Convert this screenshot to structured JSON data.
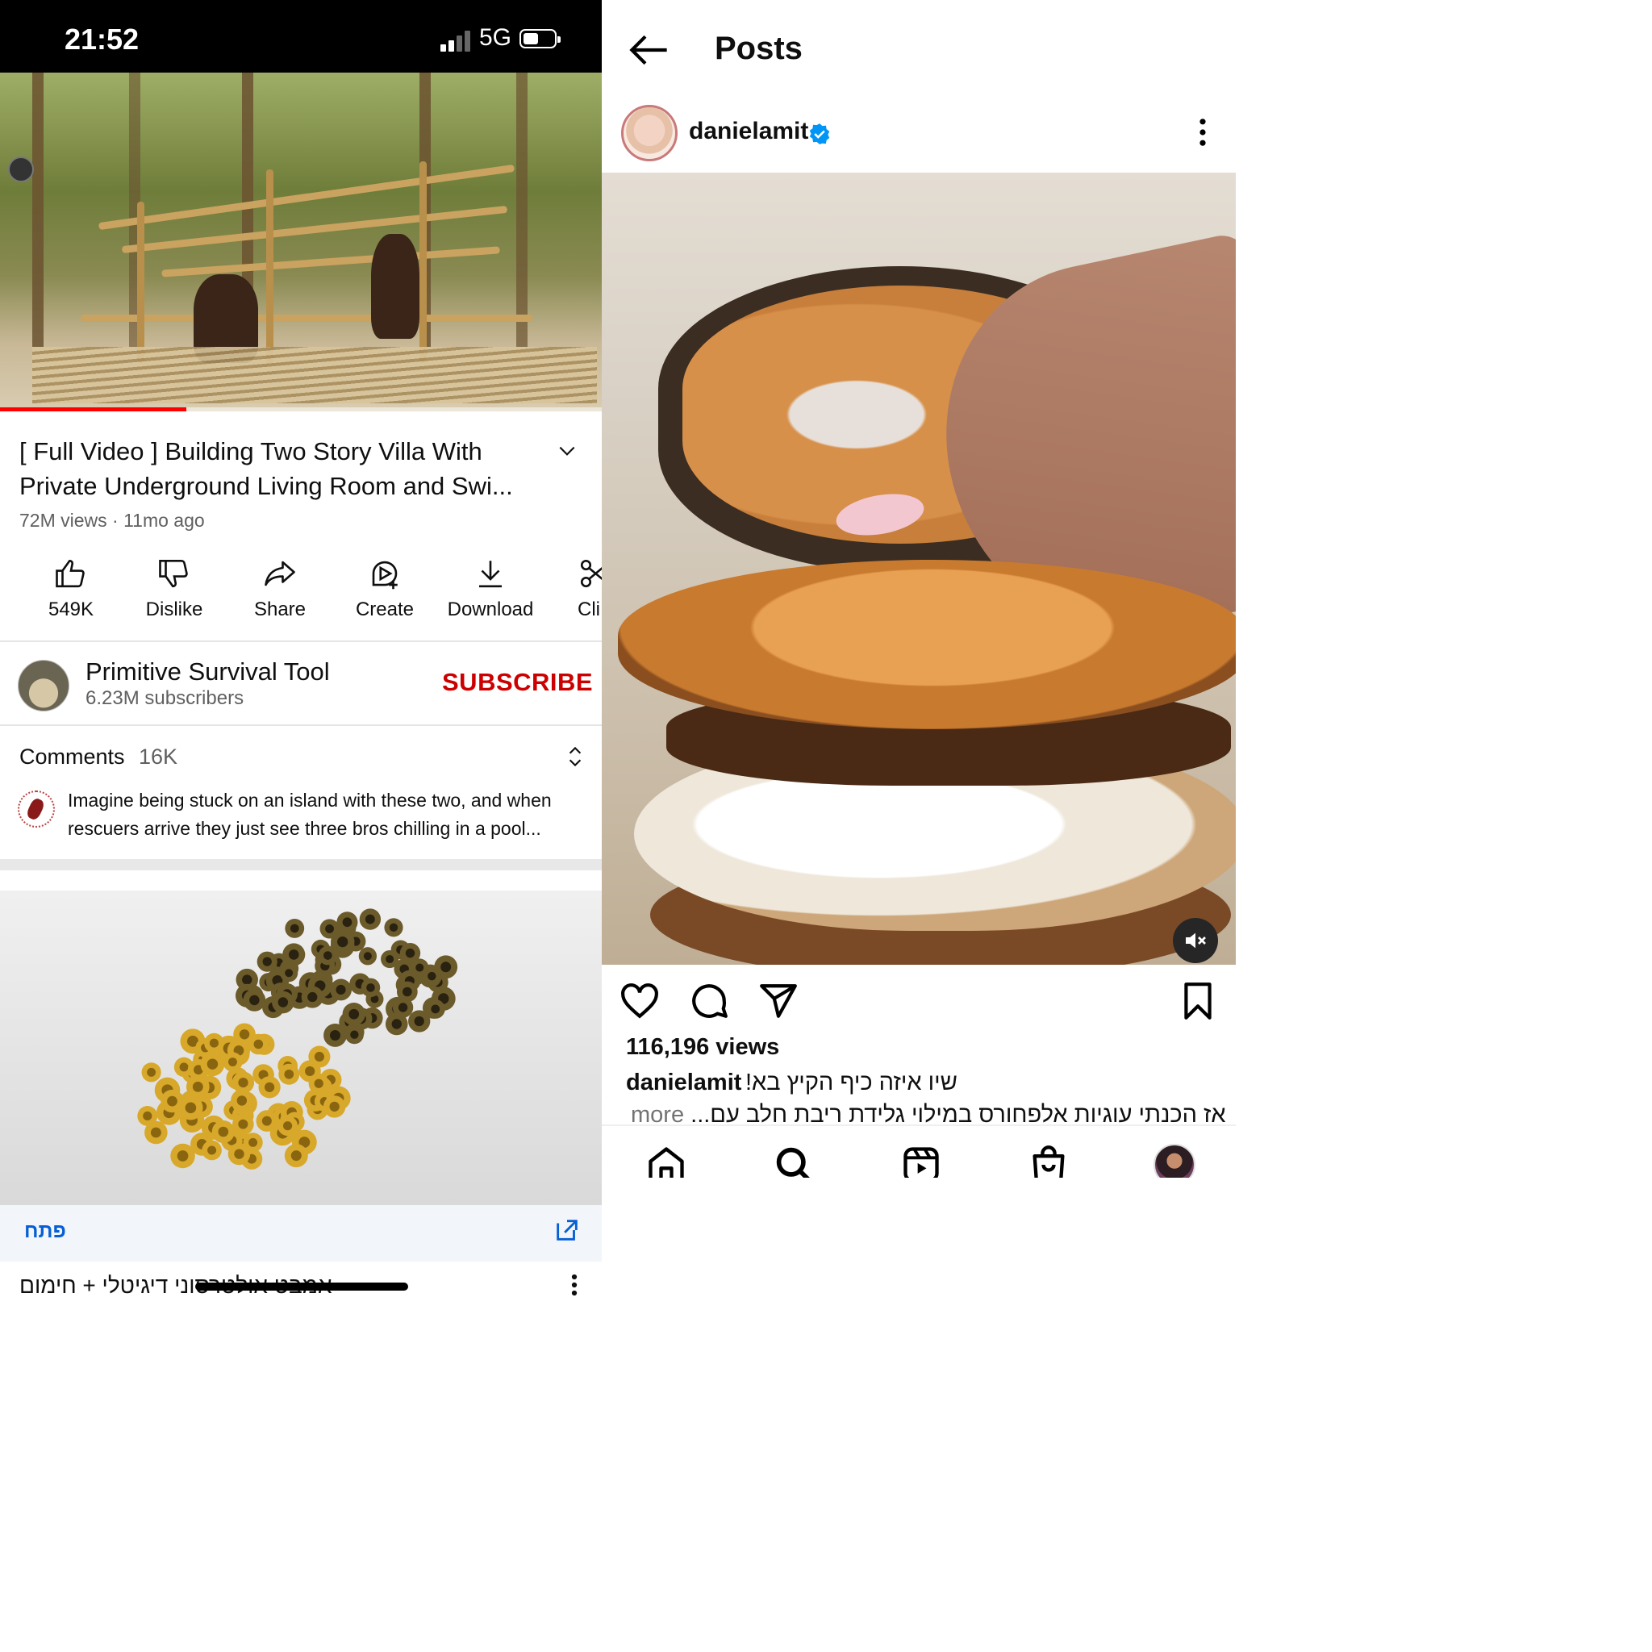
{
  "status_bar": {
    "time": "21:52",
    "network": "5G"
  },
  "youtube": {
    "progress": 0.31,
    "video": {
      "title": "[ Full Video ] Building Two Story Villa With Private Underground Living Room and Swi...",
      "meta": "72M views · 11mo ago"
    },
    "actions": [
      {
        "label": "549K",
        "icon": "thumbs-up-icon"
      },
      {
        "label": "Dislike",
        "icon": "thumbs-down-icon"
      },
      {
        "label": "Share",
        "icon": "share-icon"
      },
      {
        "label": "Create",
        "icon": "create-icon"
      },
      {
        "label": "Download",
        "icon": "download-icon"
      },
      {
        "label": "Cli",
        "icon": "clip-icon"
      }
    ],
    "channel": {
      "name": "Primitive Survival Tool",
      "subscribers": "6.23M subscribers",
      "subscribe_label": "SUBSCRIBE"
    },
    "comments": {
      "title": "Comments",
      "count": "16K",
      "top_comment": "Imagine being stuck on an island with these two, and when rescuers arrive they just see three bros chilling in a pool..."
    },
    "ad": {
      "open_label": "פתח",
      "title": "אמבט אולטרסוני דיגיטלי + חימום"
    },
    "colors": {
      "subscribe": "#cc0000",
      "progress": "#ff0000",
      "link": "#065fd4"
    }
  },
  "instagram": {
    "header_title": "Posts",
    "username": "danielamit",
    "verified": true,
    "views": "116,196 views",
    "caption_text": "שיו איזה כיף הקיץ בא!",
    "caption_line2": "אז הכנתי עוגיות אלפחורס במילוי גלידת ריבת חלב עם...",
    "more_label": "more",
    "muted": true,
    "colors": {
      "verified": "#0095f6"
    }
  }
}
